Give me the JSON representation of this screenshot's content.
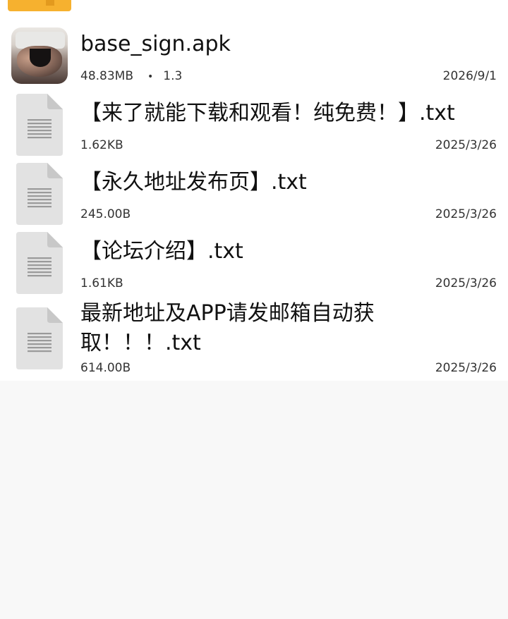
{
  "files": [
    {
      "name": "base_sign.apk",
      "size": "48.83MB",
      "version": "1.3",
      "date": "2026/9/1",
      "icon": "app-thumbnail"
    },
    {
      "name": "【来了就能下载和观看！纯免费！】.txt",
      "size": "1.62KB",
      "date": "2025/3/26",
      "icon": "text-file-icon"
    },
    {
      "name": "【永久地址发布页】.txt",
      "size": "245.00B",
      "date": "2025/3/26",
      "icon": "text-file-icon"
    },
    {
      "name": "【论坛介绍】.txt",
      "size": "1.61KB",
      "date": "2025/3/26",
      "icon": "text-file-icon"
    },
    {
      "name": "最新地址及APP请发邮箱自动获取！！！.txt",
      "size": "614.00B",
      "date": "2025/3/26",
      "icon": "text-file-icon"
    }
  ],
  "separator": "•",
  "colors": {
    "folder": "#f6b12f",
    "file_icon": "#e2e2e2",
    "file_lines": "#9a9a9a"
  }
}
